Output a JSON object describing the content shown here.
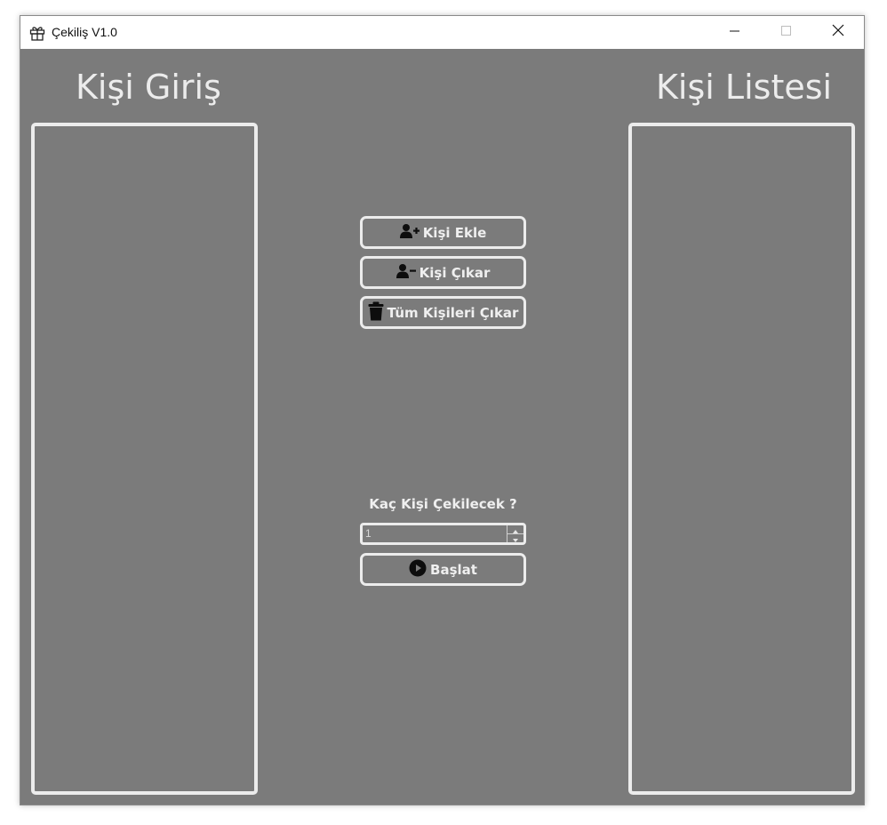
{
  "window": {
    "title": "Çekiliş V1.0",
    "icon": "gift-icon",
    "controls": [
      "minimize-icon",
      "maximize-icon",
      "close-icon"
    ]
  },
  "left_panel": {
    "heading": "Kişi Giriş"
  },
  "right_panel": {
    "heading": "Kişi Listesi"
  },
  "actions": {
    "add_label": "Kişi Ekle",
    "add_icon": "user-plus-icon",
    "remove_label": "Kişi Çıkar",
    "remove_icon": "user-minus-icon",
    "clear_label": "Tüm Kişileri Çıkar",
    "clear_icon": "trash-icon"
  },
  "draw": {
    "count_label": "Kaç Kişi Çekilecek ?",
    "count_value": "1",
    "start_label": "Başlat",
    "start_icon": "play-circle-icon"
  },
  "colors": {
    "background": "#7b7b7b",
    "foreground": "#ececec"
  }
}
